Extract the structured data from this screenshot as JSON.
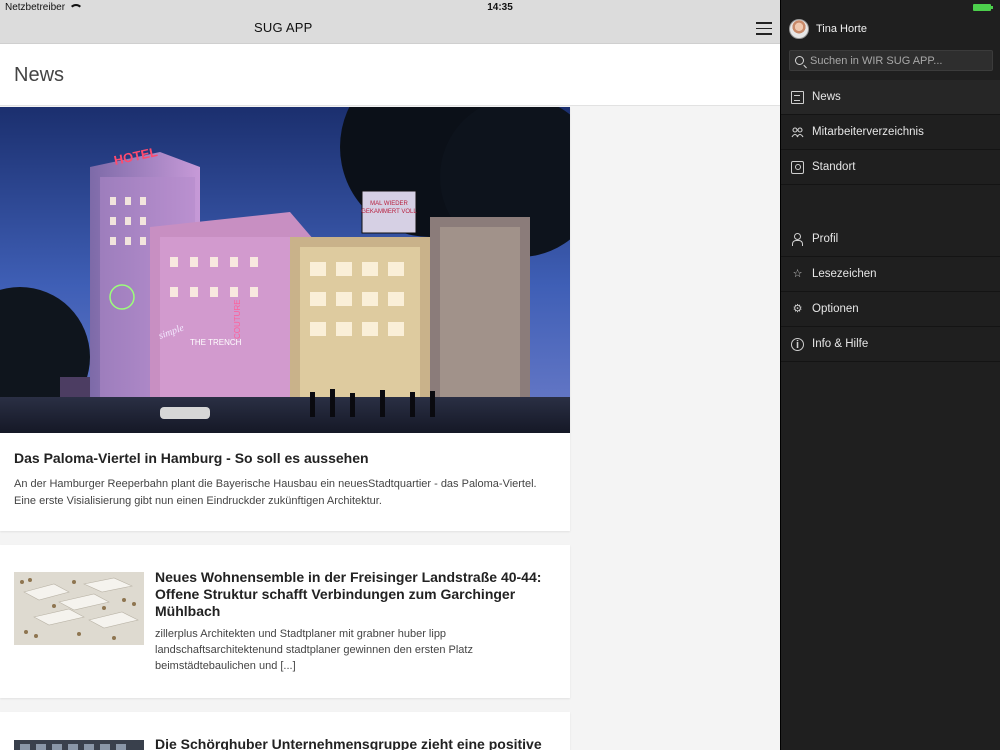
{
  "status_bar": {
    "carrier": "Netzbetreiber",
    "time": "14:35",
    "battery_color": "#4ccf4c"
  },
  "navbar": {
    "title": "SUG APP",
    "menu_icon": "hamburger-icon"
  },
  "page": {
    "title": "News"
  },
  "articles": [
    {
      "title": "Das Paloma-Viertel in Hamburg - So soll es aussehen",
      "excerpt": "An der Hamburger Reeperbahn plant die Bayerische Hausbau ein neuesStadtquartier - das Paloma-Viertel. Eine erste Visialisierung gibt nun einen Eindruckder zukünftigen Architektur.",
      "image_signs": {
        "hotel": "HOTEL",
        "billboard_1": "MAL WIEDER",
        "billboard_2": "GEKAMMERT VOLL",
        "simple": "simple",
        "trench": "THE TRENCH",
        "couture": "COUTURE"
      }
    },
    {
      "title": "Neues Wohnensemble in der Freisinger Landstraße 40-44: Offene Struktur schafft Verbindungen zum Garchinger Mühlbach",
      "excerpt": "zillerplus Architekten und Stadtplaner mit grabner huber lipp landschaftsarchitektenund stadtplaner gewinnen den ersten Platz beimstädtebaulichen und [...]"
    },
    {
      "title": "Die Schörghuber Unternehmensgruppe zieht eine positive"
    }
  ],
  "drawer": {
    "user_name": "Tina Horte",
    "search_placeholder": "Suchen in WIR SUG APP...",
    "main_items": [
      {
        "label": "News",
        "icon": "newspaper-icon"
      },
      {
        "label": "Mitarbeiterverzeichnis",
        "icon": "people-icon"
      },
      {
        "label": "Standort",
        "icon": "map-pin-icon"
      }
    ],
    "secondary_items": [
      {
        "label": "Profil",
        "icon": "user-icon"
      },
      {
        "label": "Lesezeichen",
        "icon": "star-icon"
      },
      {
        "label": "Optionen",
        "icon": "gear-icon"
      },
      {
        "label": "Info & Hilfe",
        "icon": "info-icon"
      }
    ]
  }
}
